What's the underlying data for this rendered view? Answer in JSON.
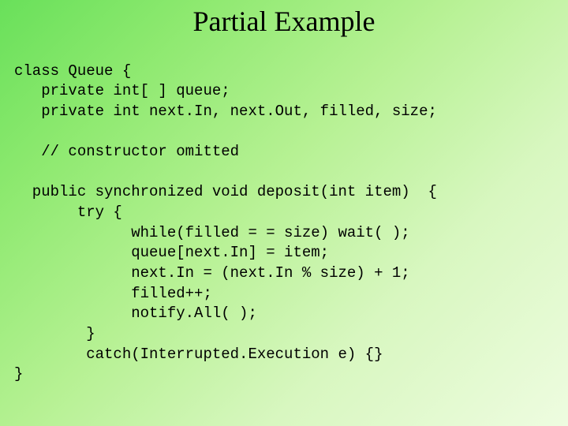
{
  "title": "Partial Example",
  "code_lines": [
    "class Queue {",
    "   private int[ ] queue;",
    "   private int next.In, next.Out, filled, size;",
    "",
    "   // constructor omitted",
    "",
    "  public synchronized void deposit(int item)  {",
    "       try {",
    "             while(filled = = size) wait( );",
    "             queue[next.In] = item;",
    "             next.In = (next.In % size) + 1;",
    "             filled++;",
    "             notify.All( );",
    "        }",
    "        catch(Interrupted.Execution e) {}",
    "}"
  ]
}
